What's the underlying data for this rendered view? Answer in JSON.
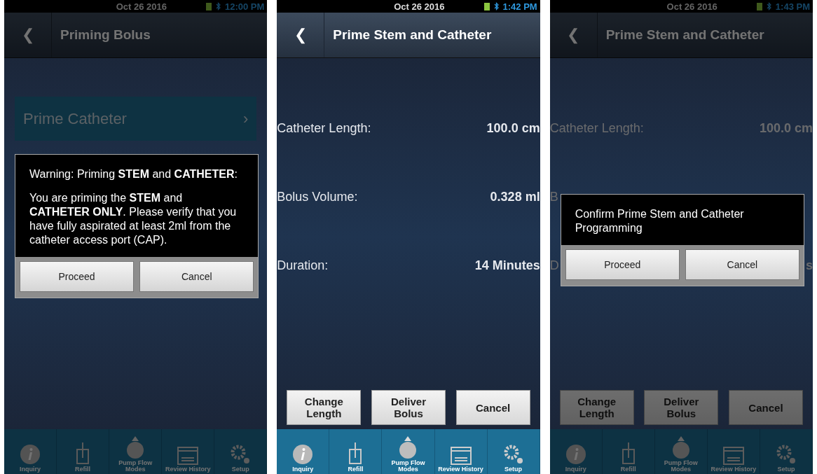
{
  "screens": [
    {
      "dimmed": true,
      "status_bar": {
        "date": "Oct 26 2016",
        "time": "12:00 PM"
      },
      "header": {
        "back": "❮",
        "title": "Priming Bolus"
      },
      "menu_items": [
        {
          "label": "Prime Catheter",
          "chevron": "›"
        }
      ],
      "dialog": {
        "kind": "warning",
        "title": "Warning: Priming **STEM** and **CATHETER**:",
        "body": "You are priming the **STEM** and **CATHETER ONLY**. Please verify that you have fully aspirated at least 2ml from the catheter access port (CAP).",
        "buttons": [
          "Proceed",
          "Cancel"
        ]
      },
      "nav": [
        "Inquiry",
        "Refill",
        "Pump Flow Modes",
        "Review History",
        "Setup"
      ]
    },
    {
      "dimmed": false,
      "status_bar": {
        "date": "Oct 26 2016",
        "time": "1:42 PM"
      },
      "header": {
        "back": "❮",
        "title": "Prime Stem and Catheter"
      },
      "rows": [
        {
          "label": "Catheter Length:",
          "value": "100.0 cm"
        },
        {
          "label": "Bolus Volume:",
          "value": "0.328 ml"
        },
        {
          "label": "Duration:",
          "value": "14 Minutes"
        }
      ],
      "actions": [
        "Change Length",
        "Deliver Bolus",
        "Cancel"
      ],
      "nav": [
        "Inquiry",
        "Refill",
        "Pump Flow Modes",
        "Review History",
        "Setup"
      ]
    },
    {
      "dimmed": true,
      "status_bar": {
        "date": "Oct 26 2016",
        "time": "1:43 PM"
      },
      "header": {
        "back": "❮",
        "title": "Prime Stem and Catheter"
      },
      "rows": [
        {
          "label": "Catheter Length:",
          "value": "100.0 cm"
        },
        {
          "label": "B"
        },
        {
          "label": "D",
          "value": "s"
        }
      ],
      "dialog": {
        "kind": "confirm",
        "title": "Confirm Prime Stem and Catheter Programming",
        "buttons": [
          "Proceed",
          "Cancel"
        ]
      },
      "actions": [
        "Change Length",
        "Deliver Bolus",
        "Cancel"
      ],
      "nav": [
        "Inquiry",
        "Refill",
        "Pump Flow Modes",
        "Review History",
        "Setup"
      ]
    }
  ]
}
